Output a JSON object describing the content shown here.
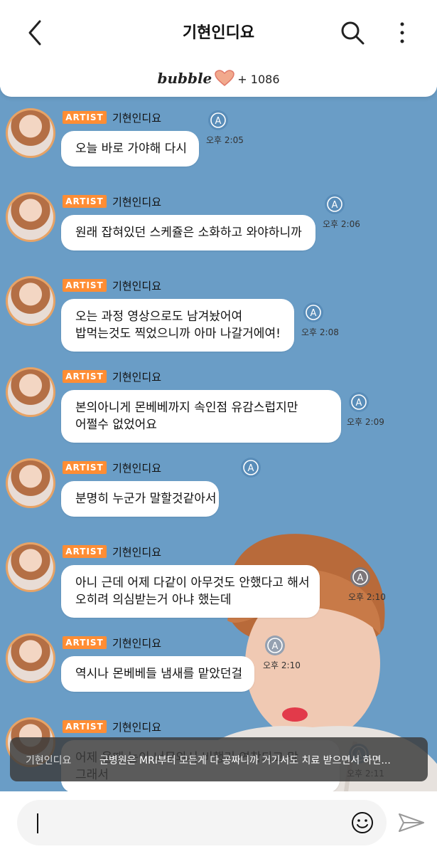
{
  "header": {
    "title": "기현인디요",
    "bubble_logo": "bubble",
    "bubble_count": "+ 1086"
  },
  "messages": [
    {
      "badge": "ARTIST",
      "name": "기현인디요",
      "lines": [
        "오늘 바로 가야해 다시"
      ],
      "time": "오후 2:05"
    },
    {
      "badge": "ARTIST",
      "name": "기현인디요",
      "lines": [
        "원래 잡혀있던 스케쥴은 소화하고 와야하니까"
      ],
      "time": "오후 2:06"
    },
    {
      "badge": "ARTIST",
      "name": "기현인디요",
      "lines": [
        "오는 과정 영상으로도 남겨놨어여",
        "밥먹는것도 찍었으니까 아마 나갈거에여!"
      ],
      "time": "오후 2:08"
    },
    {
      "badge": "ARTIST",
      "name": "기현인디요",
      "lines": [
        "본의아니게 몬베베까지 속인점 유감스럽지만",
        "어쩔수 없었어요"
      ],
      "time": "오후 2:09"
    },
    {
      "badge": "ARTIST",
      "name": "기현인디요",
      "lines": [
        "분명히 누군가 말할것같아서"
      ],
      "time": ""
    },
    {
      "badge": "ARTIST",
      "name": "기현인디요",
      "lines": [
        "아니 근데 어제 다같이 아무것도 안했다고 해서",
        "오히려 의심받는거 아냐 했는데"
      ],
      "time": "오후 2:10"
    },
    {
      "badge": "ARTIST",
      "name": "기현인디요",
      "lines": [
        "역시나 몬베베들 냄새를 맡았던걸"
      ],
      "time": "오후 2:10"
    },
    {
      "badge": "ARTIST",
      "name": "기현인디요",
      "lines": [
        "어제 올때 눈이 너무와서 비행기 연착되고 막",
        "그래서"
      ],
      "time": "오후 2:11"
    }
  ],
  "toast": {
    "name": "기현인디요",
    "text": "군병원은 MRI부터 모든게 다 공짜니까 거기서도 치료 받으면서 하면..."
  },
  "icons": {
    "back": "chevron-left-icon",
    "search": "search-icon",
    "more": "more-vertical-icon",
    "translate": "translate-icon",
    "emoji": "emoji-icon",
    "send": "send-icon",
    "heart": "heart-icon"
  },
  "colors": {
    "chat_bg": "#6a9dc6",
    "badge": "#ff8d34",
    "avatar_ring": "#e7a366"
  }
}
